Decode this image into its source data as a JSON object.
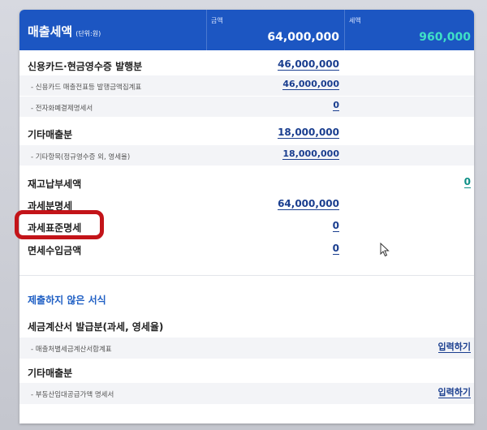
{
  "header": {
    "title": "매출세액",
    "unit": "(단위:원)",
    "amount_label": "금액",
    "amount_value": "64,000,000",
    "tax_label": "세액",
    "tax_value": "960,000"
  },
  "rows": [
    {
      "label": "신용카드·현금영수증 발행분",
      "amount": "46,000,000"
    },
    {
      "label": "- 신용카드 매출전표등 발행금액집계표",
      "amount": "46,000,000"
    },
    {
      "label": "- 전자화폐결제명세서",
      "amount": "0"
    },
    {
      "label": "기타매출분",
      "amount": "18,000,000"
    },
    {
      "label": "- 기타항목(정규영수증 외, 영세율)",
      "amount": "18,000,000"
    },
    {
      "label": "재고납부세액",
      "tax": "0"
    },
    {
      "label": "과세분명세",
      "amount": "64,000,000"
    },
    {
      "label": "과세표준명세",
      "amount": "0"
    },
    {
      "label": "면세수입금액",
      "amount": "0"
    }
  ],
  "unsubmitted": {
    "title": "제출하지 않은 서식",
    "groups": [
      {
        "label": "세금계산서 발급분(과세, 영세율)",
        "item": "- 매출처별세금계산서합계표",
        "action": "입력하기"
      },
      {
        "label": "기타매출분",
        "item": "- 부동산임대공급가액 명세서",
        "action": "입력하기"
      }
    ]
  },
  "colors": {
    "header_bg": "#1c56c2",
    "highlight": "#c31419",
    "tax_accent": "#3fe0c6",
    "link": "#1a3e8f"
  }
}
